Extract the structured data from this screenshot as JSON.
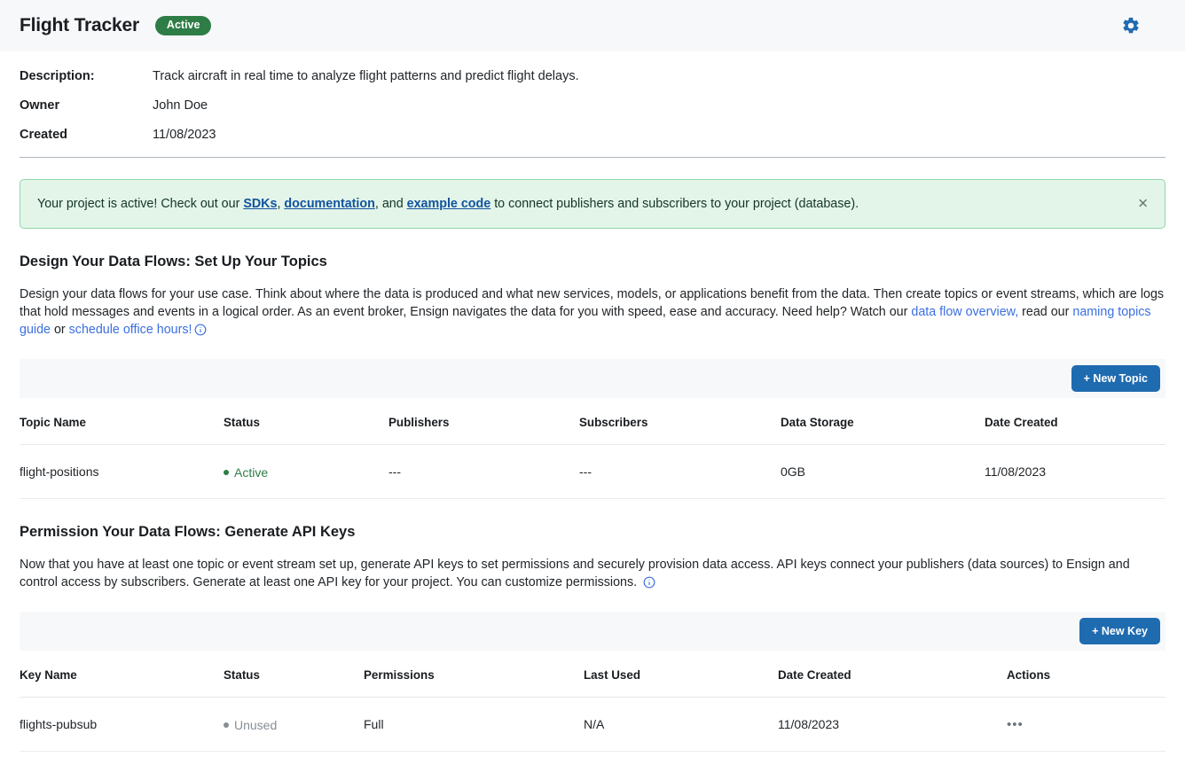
{
  "header": {
    "title": "Flight Tracker",
    "status_badge": "Active",
    "gear_icon": "gear-icon",
    "accent_blue": "#1f6bb0",
    "badge_green": "#2e7d46"
  },
  "meta": {
    "rows": [
      {
        "label": "Description:",
        "value": "Track aircraft in real time to analyze flight patterns and predict flight delays."
      },
      {
        "label": "Owner",
        "value": "John Doe"
      },
      {
        "label": "Created",
        "value": "11/08/2023"
      }
    ]
  },
  "alert": {
    "lead": "Your project is active! Check out our ",
    "link1": "SDKs",
    "sep1": ", ",
    "link2": "documentation",
    "sep2": ", and ",
    "link3": "example code",
    "tail": " to connect publishers and subscribers to your project (database).",
    "close_label": "✕",
    "bg": "#e3f5e9",
    "border": "#8fd6a9"
  },
  "topics_section": {
    "title": "Design Your Data Flows: Set Up Your Topics",
    "body_part1": "Design your data flows for your use case. Think about where the data is produced and what new services, models, or applications benefit from the data. Then create topics or event streams, which are logs that hold messages and events in a logical order. As an event broker, Ensign navigates the data for you with speed, ease and accuracy. Need help? Watch our ",
    "link_overview": "data flow overview,",
    "body_part2": " read our ",
    "link_naming": "naming topics guide",
    "body_part3": " or ",
    "link_office": "schedule office hours!",
    "new_button": "+ New Topic",
    "columns": [
      "Topic Name",
      "Status",
      "Publishers",
      "Subscribers",
      "Data Storage",
      "Date Created"
    ],
    "rows": [
      {
        "name": "flight-positions",
        "status": "Active",
        "status_kind": "active",
        "publishers": "---",
        "subscribers": "---",
        "storage": "0GB",
        "created": "11/08/2023"
      }
    ]
  },
  "keys_section": {
    "title": "Permission Your Data Flows: Generate API Keys",
    "body": "Now that you have at least one topic or event stream set up, generate API keys to set permissions and securely provision data access. API keys connect your publishers (data sources) to Ensign and control access by subscribers. Generate at least one API key for your project. You can customize permissions. ",
    "new_button": "+ New Key",
    "columns": [
      "Key Name",
      "Status",
      "Permissions",
      "Last Used",
      "Date Created",
      "Actions"
    ],
    "rows": [
      {
        "name": "flights-pubsub",
        "status": "Unused",
        "status_kind": "unused",
        "permissions": "Full",
        "last_used": "N/A",
        "created": "11/08/2023",
        "actions": "•••"
      }
    ]
  }
}
